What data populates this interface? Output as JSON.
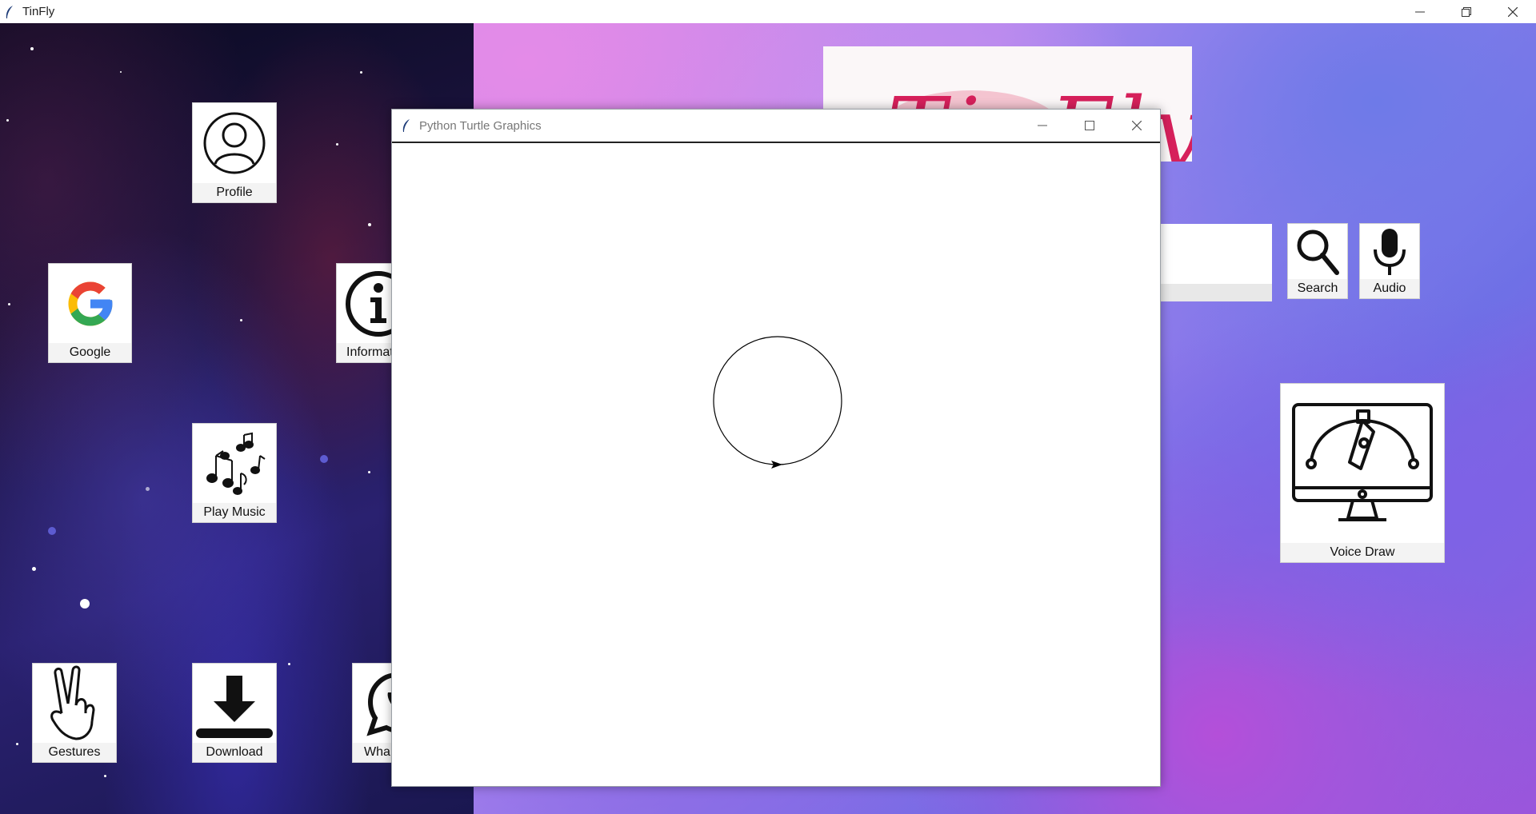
{
  "app": {
    "title": "TinFly",
    "icon": "feather-icon"
  },
  "window_controls": [
    "minimize-icon",
    "restore-icon",
    "close-icon"
  ],
  "logo": {
    "text": "TinFly"
  },
  "tiles": {
    "profile": {
      "label": "Profile",
      "icon": "user-circle-icon"
    },
    "google": {
      "label": "Google",
      "icon": "google-g-icon"
    },
    "information": {
      "label": "Informat",
      "icon": "info-icon"
    },
    "play_music": {
      "label": "Play Music",
      "icon": "music-notes-icon"
    },
    "gestures": {
      "label": "Gestures",
      "icon": "peace-hand-icon"
    },
    "download": {
      "label": "Download",
      "icon": "download-icon"
    },
    "whatsapp": {
      "label": "Wha",
      "icon": "whatsapp-icon"
    },
    "search": {
      "label": "Search",
      "icon": "magnifier-icon"
    },
    "audio": {
      "label": "Audio",
      "icon": "microphone-icon"
    },
    "voice_draw": {
      "label": "Voice Draw",
      "icon": "monitor-drawing-icon"
    }
  },
  "search_entry": {
    "value": ""
  },
  "turtle_window": {
    "title": "Python Turtle Graphics",
    "icon": "feather-icon",
    "drawing": {
      "shape": "circle",
      "pen_color": "#000000",
      "turtle_heading_deg": 0
    }
  },
  "colors": {
    "google_blue": "#4285F4",
    "google_red": "#EA4335",
    "google_yellow": "#FBBC05",
    "google_green": "#34A853",
    "logo_pink": "#d6205b"
  }
}
